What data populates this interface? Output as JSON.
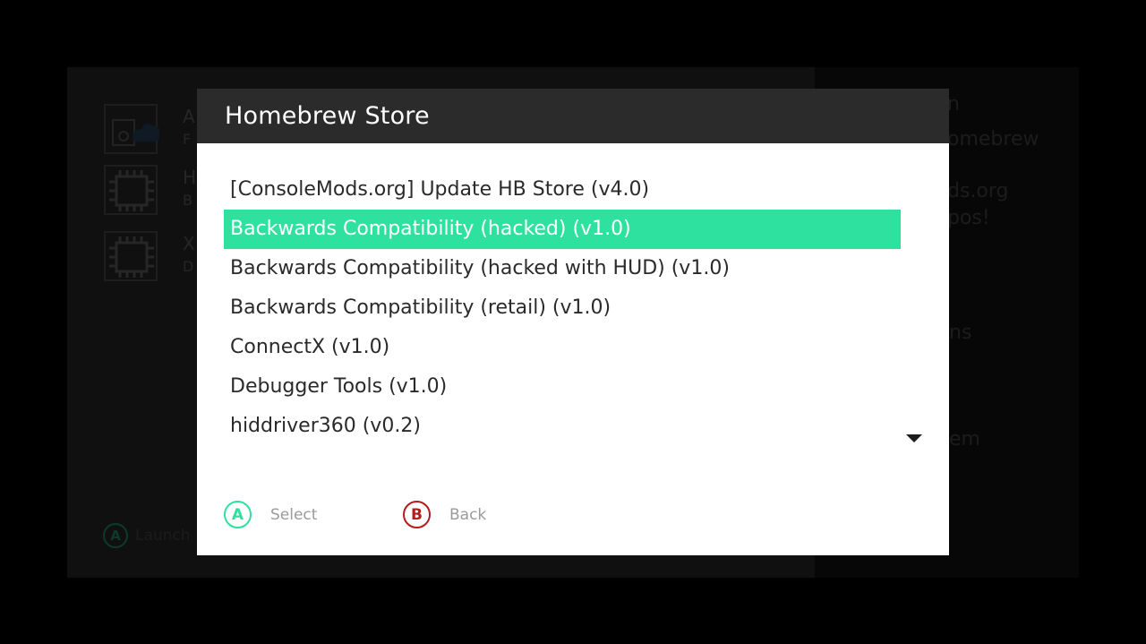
{
  "dialog": {
    "title": "Homebrew Store",
    "items": [
      {
        "label": "[ConsoleMods.org] Update HB Store (v4.0)",
        "selected": false
      },
      {
        "label": "Backwards Compatibility (hacked) (v1.0)",
        "selected": true
      },
      {
        "label": "Backwards Compatibility (hacked with HUD) (v1.0)",
        "selected": false
      },
      {
        "label": "Backwards Compatibility (retail) (v1.0)",
        "selected": false
      },
      {
        "label": "ConnectX (v1.0)",
        "selected": false
      },
      {
        "label": "Debugger Tools (v1.0)",
        "selected": false
      },
      {
        "label": "hiddriver360 (v0.2)",
        "selected": false
      }
    ],
    "scroll_indicator_icon": "triangle-down-icon",
    "hints": {
      "select": {
        "button": "A",
        "label": "Select",
        "color": "#2ee19f"
      },
      "back": {
        "button": "B",
        "label": "Back",
        "color": "#b41c1c"
      }
    }
  },
  "background": {
    "rows": [
      {
        "line1": "A",
        "line2": "F",
        "icon": "cloud-icon"
      },
      {
        "line1": "H",
        "line2": "B",
        "icon": "chip-icon"
      },
      {
        "line1": "X",
        "line2": "D",
        "icon": "chip-icon"
      }
    ],
    "right_panel": {
      "lines": [
        "n",
        "omebrew",
        "ds.org",
        "pos!",
        "ns",
        "em"
      ]
    },
    "hint": {
      "button": "A",
      "label": "Launch"
    }
  },
  "colors": {
    "accent": "#2ee19f",
    "back_button": "#b41c1c",
    "header": "#2b2b2b"
  }
}
